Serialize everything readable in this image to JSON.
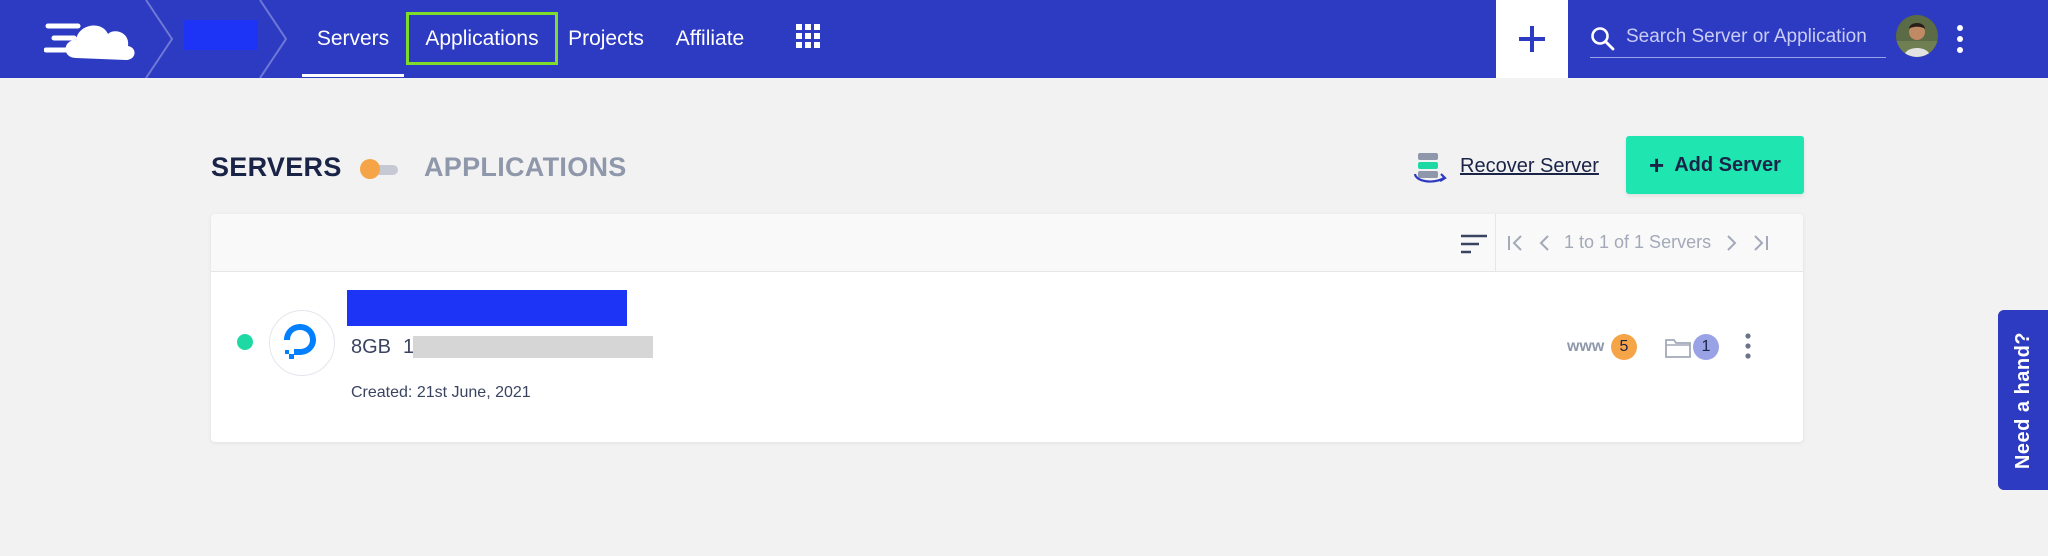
{
  "nav": {
    "items": [
      {
        "label": "Servers"
      },
      {
        "label": "Applications"
      },
      {
        "label": "Projects"
      },
      {
        "label": "Affiliate"
      }
    ],
    "plus_label": "+",
    "search_placeholder": "Search Server or Application"
  },
  "page": {
    "toggle_left": "SERVERS",
    "toggle_right": "APPLICATIONS",
    "recover_label": "Recover Server",
    "add_server_label": "Add Server",
    "add_server_plus": "+"
  },
  "table": {
    "pagination_text": "1 to 1 of 1 Servers"
  },
  "servers": [
    {
      "size": "8GB",
      "ip_prefix": "1",
      "created": "Created: 21st June, 2021",
      "www_label": "www",
      "apps_count": "5",
      "projects_count": "1"
    }
  ],
  "help": {
    "label": "Need a hand?"
  },
  "colors": {
    "nav_bg": "#2d3ac2",
    "accent_green": "#1fe6b1",
    "status_online": "#1fd9a5",
    "badge_orange": "#f5a547",
    "badge_purple": "#9aa2e6",
    "highlight_box": "#7ddd2a"
  },
  "icons": [
    "cloudways-logo-icon",
    "breadcrumb-chevron-icon",
    "apps-grid-icon",
    "plus-icon",
    "search-icon",
    "kebab-icon",
    "recover-server-icon",
    "sort-icon",
    "first-page-icon",
    "prev-page-icon",
    "next-page-icon",
    "last-page-icon",
    "digitalocean-logo-icon",
    "folder-icon"
  ]
}
